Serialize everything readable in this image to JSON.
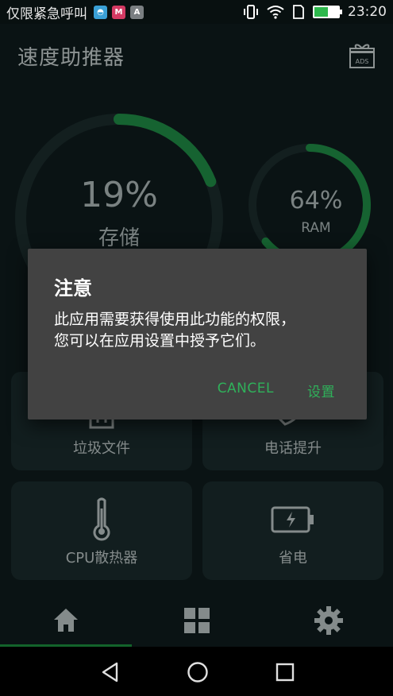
{
  "status_bar": {
    "carrier": "仅限紧急呼叫",
    "notifications": [
      {
        "icon": "android-icon",
        "color": "#3aa0d6",
        "glyph": "◓"
      },
      {
        "icon": "gmail-icon",
        "color": "#d33a63",
        "glyph": "M"
      },
      {
        "icon": "app-a-icon",
        "color": "#7a7f82",
        "glyph": "A"
      }
    ],
    "battery_level": 0.55,
    "time": "23:20"
  },
  "app_bar": {
    "title": "速度助推器",
    "ads_label": "ADS"
  },
  "gauges": {
    "storage": {
      "percent": 19,
      "value_text": "19%",
      "label": "存储"
    },
    "ram": {
      "percent": 64,
      "value_text": "64%",
      "label": "RAM"
    }
  },
  "features": [
    {
      "label": "垃圾文件",
      "icon": "trash-icon"
    },
    {
      "label": "电话提升",
      "icon": "rocket-icon"
    },
    {
      "label": "CPU散热器",
      "icon": "thermometer-icon"
    },
    {
      "label": "省电",
      "icon": "battery-charge-icon"
    }
  ],
  "bottom_nav": [
    {
      "icon": "home-icon",
      "active": true
    },
    {
      "icon": "grid-icon",
      "active": false
    },
    {
      "icon": "gear-icon",
      "active": false
    }
  ],
  "dialog": {
    "title": "注意",
    "message_line1": "此应用需要获得使用此功能的权限，",
    "message_line2": "您可以在应用设置中授予它们。",
    "cancel_label": "CANCEL",
    "settings_label": "设置"
  },
  "colors": {
    "accent": "#2fb15a",
    "background": "#0e1b1c",
    "card": "#1a2a2b",
    "dialog": "#424242",
    "gauge_track": "#1b2b2c",
    "gauge_progress": "#1f8a44"
  }
}
